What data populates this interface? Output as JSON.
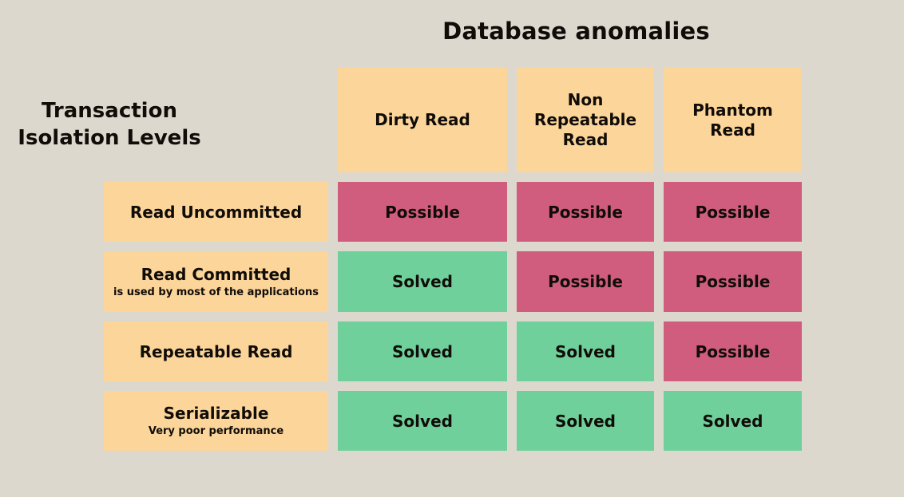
{
  "title": "Database anomalies",
  "axis_caption": {
    "line1": "Transaction",
    "line2": "Isolation Levels"
  },
  "colors": {
    "background": "#dcd8ce",
    "header": "#fcd59a",
    "possible": "#d05d7e",
    "solved": "#6fd09b",
    "text": "#100c08"
  },
  "columns": [
    {
      "id": "dirty-read",
      "lines": [
        "Dirty Read"
      ]
    },
    {
      "id": "non-repeatable-read",
      "lines": [
        "Non",
        "Repeatable",
        "Read"
      ]
    },
    {
      "id": "phantom-read",
      "lines": [
        "Phantom",
        "Read"
      ]
    }
  ],
  "rows": [
    {
      "id": "read-uncommitted",
      "title": "Read Uncommitted",
      "subtitle": "",
      "cells": [
        {
          "label": "Possible",
          "state": "possible"
        },
        {
          "label": "Possible",
          "state": "possible"
        },
        {
          "label": "Possible",
          "state": "possible"
        }
      ]
    },
    {
      "id": "read-committed",
      "title": "Read Committed",
      "subtitle": "is used by most of the applications",
      "cells": [
        {
          "label": "Solved",
          "state": "solved"
        },
        {
          "label": "Possible",
          "state": "possible"
        },
        {
          "label": "Possible",
          "state": "possible"
        }
      ]
    },
    {
      "id": "repeatable-read",
      "title": "Repeatable Read",
      "subtitle": "",
      "cells": [
        {
          "label": "Solved",
          "state": "solved"
        },
        {
          "label": "Solved",
          "state": "solved"
        },
        {
          "label": "Possible",
          "state": "possible"
        }
      ]
    },
    {
      "id": "serializable",
      "title": "Serializable",
      "subtitle": "Very poor performance",
      "cells": [
        {
          "label": "Solved",
          "state": "solved"
        },
        {
          "label": "Solved",
          "state": "solved"
        },
        {
          "label": "Solved",
          "state": "solved"
        }
      ]
    }
  ],
  "chart_data": {
    "type": "table",
    "title": "Database anomalies",
    "xlabel": "Database anomalies",
    "ylabel": "Transaction Isolation Levels",
    "categories": [
      "Dirty Read",
      "Non Repeatable Read",
      "Phantom Read"
    ],
    "row_labels": [
      "Read Uncommitted",
      "Read Committed",
      "Repeatable Read",
      "Serializable"
    ],
    "row_notes": [
      "",
      "is used by most of the applications",
      "",
      "Very poor performance"
    ],
    "values": [
      [
        "Possible",
        "Possible",
        "Possible"
      ],
      [
        "Solved",
        "Possible",
        "Possible"
      ],
      [
        "Solved",
        "Solved",
        "Possible"
      ],
      [
        "Solved",
        "Solved",
        "Solved"
      ]
    ],
    "legend": [
      "Possible",
      "Solved"
    ]
  }
}
